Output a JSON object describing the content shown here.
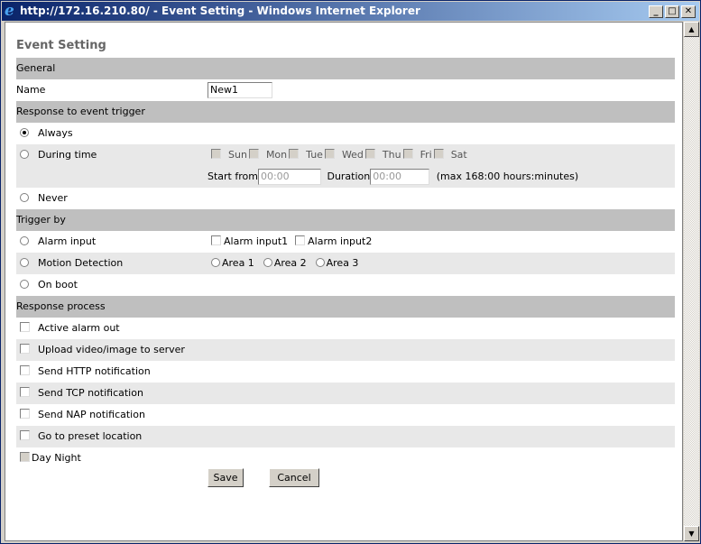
{
  "window": {
    "title": "http://172.16.210.80/ - Event Setting - Windows Internet Explorer"
  },
  "page_title": "Event Setting",
  "general": {
    "header": "General",
    "name_label": "Name",
    "name_value": "New1"
  },
  "response_trigger": {
    "header": "Response to event trigger",
    "always": "Always",
    "during_time": "During time",
    "never": "Never",
    "days": [
      "Sun",
      "Mon",
      "Tue",
      "Wed",
      "Thu",
      "Fri",
      "Sat"
    ],
    "start_from_label": "Start from",
    "start_from_placeholder": "00:00",
    "duration_label": "Duration",
    "duration_placeholder": "00:00",
    "max_note": "(max 168:00 hours:minutes)"
  },
  "trigger_by": {
    "header": "Trigger by",
    "alarm_input": "Alarm input",
    "alarm_input1": "Alarm input1",
    "alarm_input2": "Alarm input2",
    "motion_detection": "Motion Detection",
    "area1": "Area 1",
    "area2": "Area 2",
    "area3": "Area 3",
    "on_boot": "On boot"
  },
  "response_process": {
    "header": "Response process",
    "items": [
      "Active alarm out",
      "Upload video/image to server",
      "Send HTTP notification",
      "Send TCP notification",
      "Send NAP notification",
      "Go to preset location"
    ],
    "day_night": "Day Night"
  },
  "buttons": {
    "save": "Save",
    "cancel": "Cancel"
  }
}
